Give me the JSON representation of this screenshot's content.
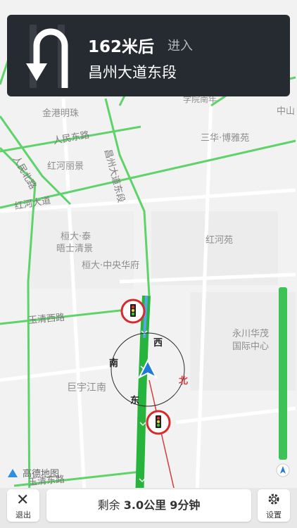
{
  "nav": {
    "distance": "162米后",
    "enter": "进入",
    "street": "昌州大道东段"
  },
  "map": {
    "places": [
      "金港明珠",
      "红河丽景",
      "桓大·泰",
      "晤士清景",
      "桓大·中央华府",
      "红河苑",
      "三华·博雅苑",
      "永川华茂",
      "国际中心",
      "巨宇江南",
      "中山",
      "学院南年"
    ],
    "roads": [
      "人民东路",
      "人民北路",
      "红河大道",
      "昌州大道东段",
      "玉清西路",
      "玉清东路"
    ],
    "compass": {
      "north": "北",
      "south": "南",
      "east": "东",
      "west": "西"
    },
    "brand": "高德地图"
  },
  "bottom": {
    "exit_label": "退出",
    "remaining_prefix": "剩余",
    "remaining_distance": "3.0公里",
    "remaining_time": "9分钟",
    "settings_label": "设置"
  },
  "colors": {
    "road_green": "#5ed36a",
    "route_green": "#27b43c",
    "panel_bg": "#262a31"
  }
}
